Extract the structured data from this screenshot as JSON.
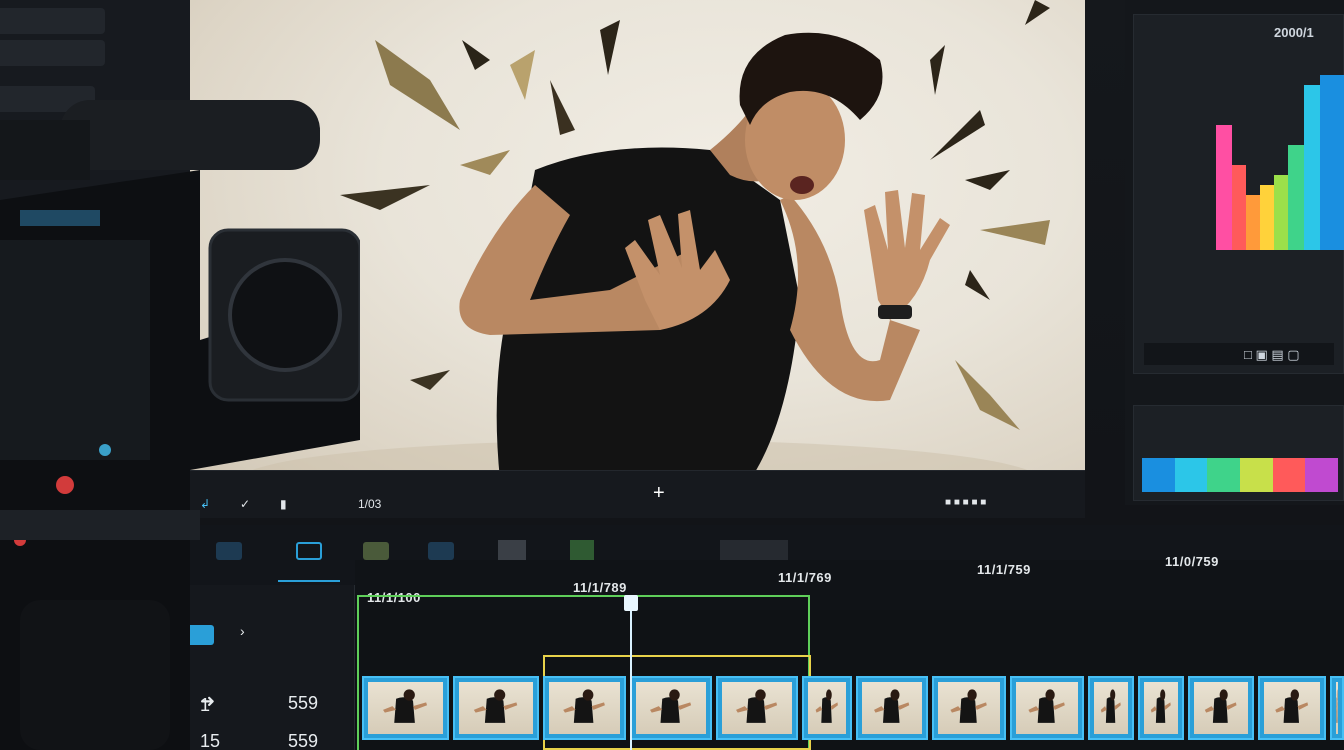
{
  "viewer": {
    "timecode": "1/03",
    "add_symbol": "+"
  },
  "right_panel": {
    "resolution_label": "2000/1",
    "palette_colors": [
      "#1a8fe0",
      "#2cc6e8",
      "#3fd38a",
      "#c8e04a",
      "#ff5a5a",
      "#c04ad0"
    ],
    "histogram_colors": [
      "#ff4fa3",
      "#ff5a5a",
      "#ff9a3a",
      "#ffd23a",
      "#9be04a",
      "#3fd38a",
      "#2cc6e8",
      "#1a8fe0"
    ]
  },
  "timeline": {
    "ruler_labels": [
      "11/1/100",
      "11/1/789",
      "11/1/769",
      "11/1/759",
      "11/0/759"
    ],
    "rows": [
      {
        "number": "1",
        "value": "559"
      },
      {
        "number": "15",
        "value": "559"
      }
    ]
  },
  "colors": {
    "selection_green": "#5fcf5a",
    "selection_yellow": "#e8d24a",
    "clip_blue": "#2a9fd8",
    "playhead": "#d9f2ff"
  }
}
